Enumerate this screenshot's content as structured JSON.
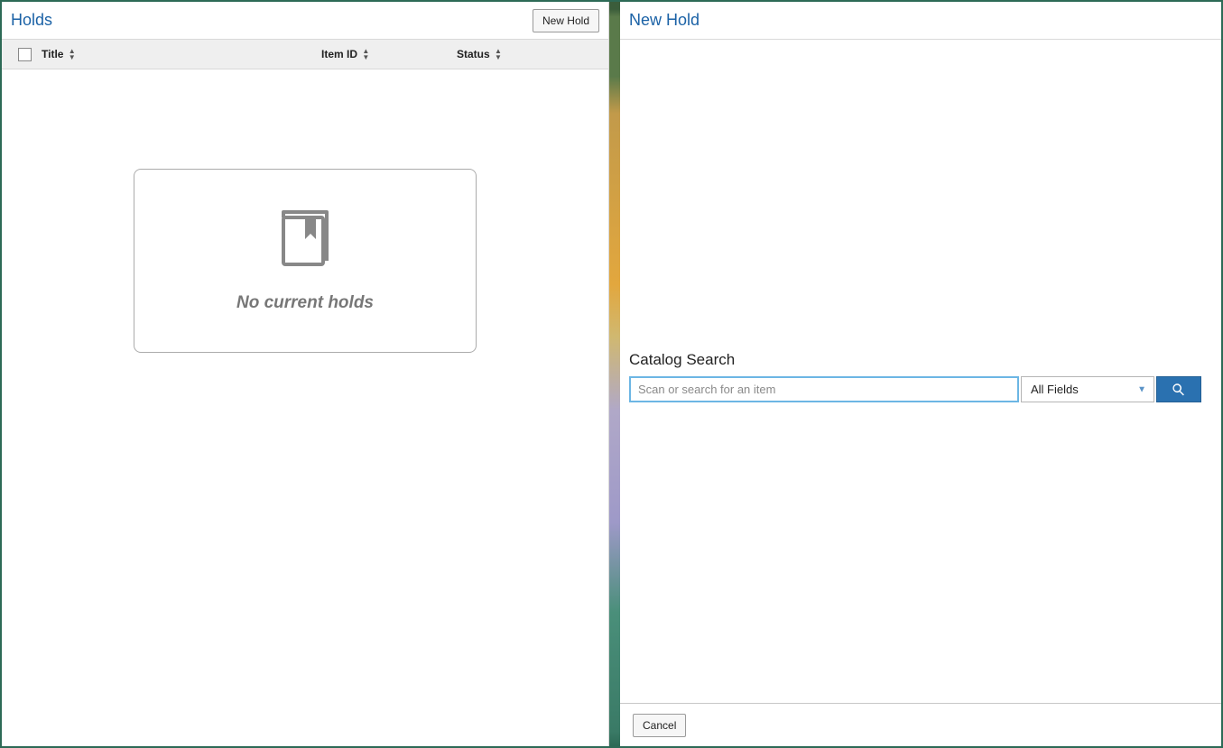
{
  "left": {
    "title": "Holds",
    "new_hold_button": "New Hold",
    "columns": {
      "title": "Title",
      "item_id": "Item ID",
      "status": "Status"
    },
    "empty_message": "No current holds"
  },
  "right": {
    "title": "New Hold",
    "catalog": {
      "label": "Catalog Search",
      "placeholder": "Scan or search for an item",
      "select_value": "All Fields"
    },
    "cancel_button": "Cancel"
  }
}
